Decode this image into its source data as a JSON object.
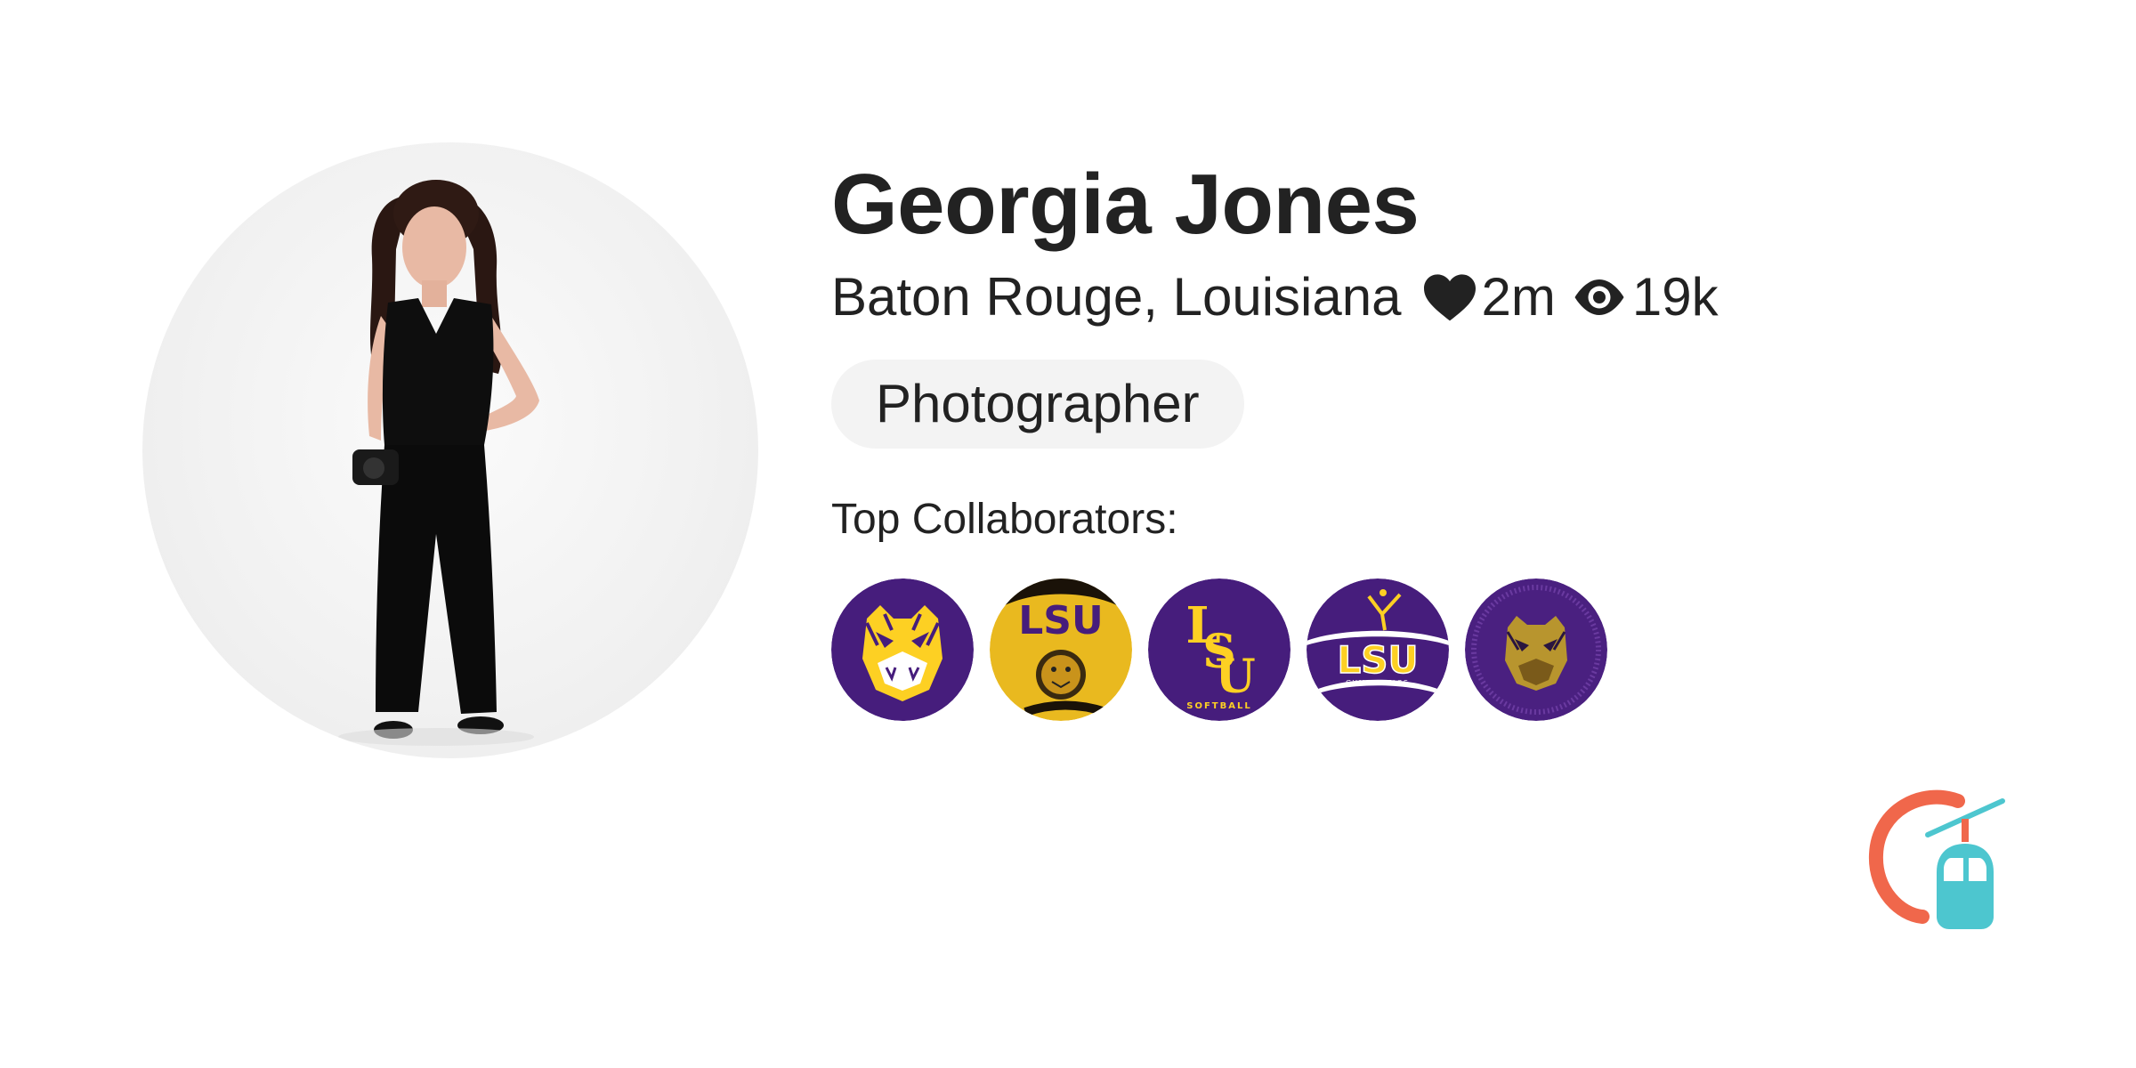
{
  "profile": {
    "name": "Georgia Jones",
    "location": "Baton Rouge, Louisiana",
    "likes": "2m",
    "views": "19k",
    "role": "Photographer",
    "avatar_icon": "person-photo"
  },
  "collaborators": {
    "title": "Top Collaborators:",
    "items": [
      {
        "icon": "lsu-tiger-face-logo",
        "label": ""
      },
      {
        "icon": "lsu-helmet-logo",
        "label": "LSU"
      },
      {
        "icon": "lsu-softball-logo",
        "label": "SOFTBALL"
      },
      {
        "icon": "lsu-gymnastics-logo",
        "label": "LSU"
      },
      {
        "icon": "lsu-gold-tiger-logo",
        "label": ""
      }
    ]
  },
  "gymnastics_sub": "GYMNASTICS",
  "colors": {
    "lsu_purple": "#461D7C",
    "lsu_gold": "#FDD023",
    "brand_orange": "#F0674B",
    "brand_teal": "#4DC6CF",
    "text": "#222222",
    "pill_bg": "#F3F3F3"
  },
  "brand": {
    "icon": "gondola-logo"
  }
}
